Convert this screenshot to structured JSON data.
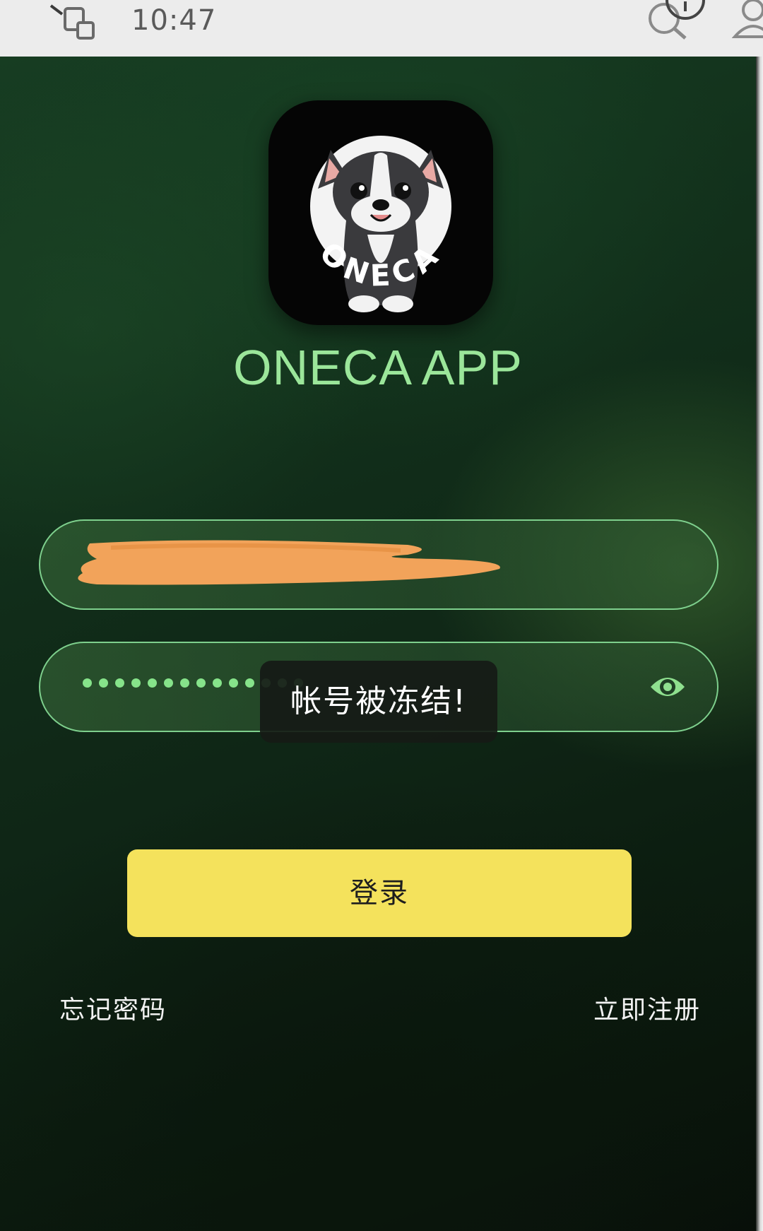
{
  "status_bar": {
    "time": "10:47",
    "icons": [
      "cast-screen-icon",
      "search-icon",
      "info-icon",
      "profile-icon"
    ]
  },
  "app": {
    "name": "ONECA APP",
    "logo_text": "ONECA",
    "logo_description": "bulldog-logo"
  },
  "form": {
    "account_value_redacted": true,
    "password_masked_dots": 14,
    "password_visibility_icon": "eye-icon",
    "login_label": "登录",
    "forgot_password_label": "忘记密码",
    "register_label": "立即注册"
  },
  "toast": {
    "message": "帐号被冻结!"
  },
  "colors": {
    "accent_green": "#9be69a",
    "field_border": "#7ed08d",
    "login_button": "#f4e25c",
    "redaction": "#f2a35a"
  }
}
